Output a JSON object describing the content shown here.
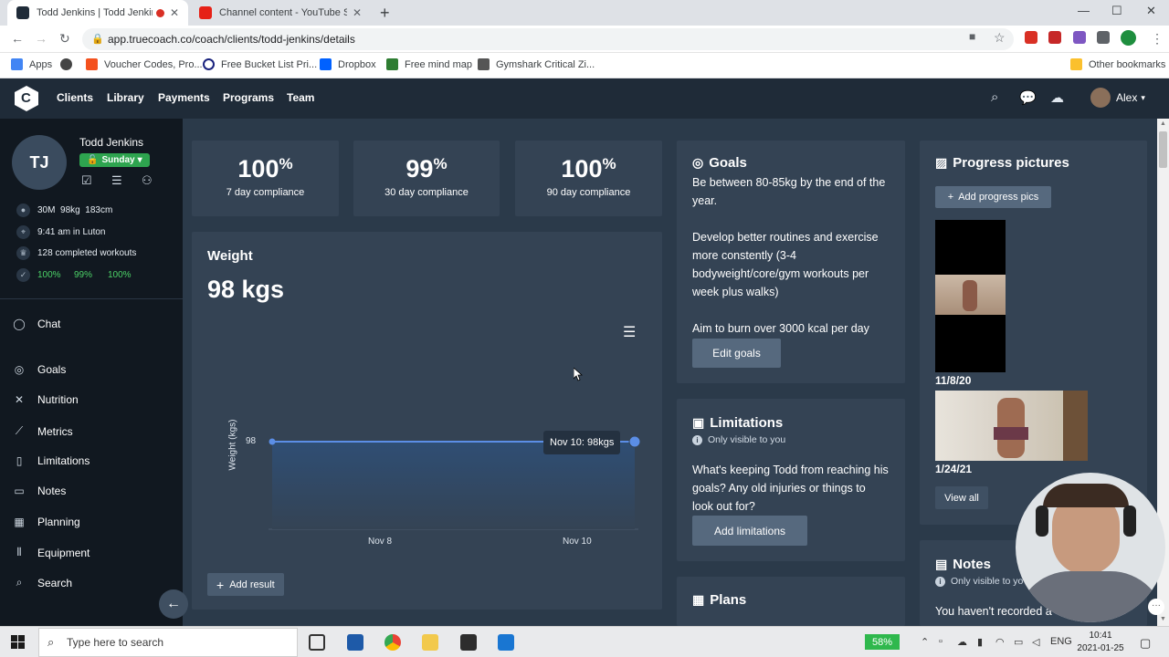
{
  "browser": {
    "tabs": [
      {
        "title": "Todd Jenkins | Todd Jenkins",
        "active": true
      },
      {
        "title": "Channel content - YouTube Studio",
        "active": false
      }
    ],
    "url": "app.truecoach.co/coach/clients/todd-jenkins/details",
    "bookmarks": [
      "Apps",
      "Voucher Codes, Pro...",
      "Free Bucket List Pri...",
      "Dropbox",
      "Free mind map",
      "Gymshark Critical Zi...",
      "Other bookmarks"
    ]
  },
  "appnav": {
    "links": [
      "Clients",
      "Library",
      "Payments",
      "Programs",
      "Team"
    ],
    "user": "Alex"
  },
  "client": {
    "initials": "TJ",
    "name": "Todd Jenkins",
    "day": "Sunday",
    "age_sex": "30M",
    "weight": "98kg",
    "height": "183cm",
    "local_time": "9:41 am in Luton",
    "workouts": "128 completed workouts",
    "compliance_small": [
      "100%",
      "99%",
      "100%"
    ]
  },
  "sidebar_menu": [
    "Chat",
    "Goals",
    "Nutrition",
    "Metrics",
    "Limitations",
    "Notes",
    "Planning",
    "Equipment",
    "Search"
  ],
  "compliance": [
    {
      "value": "100",
      "unit": "%",
      "label": "7 day compliance"
    },
    {
      "value": "99",
      "unit": "%",
      "label": "30 day compliance"
    },
    {
      "value": "100",
      "unit": "%",
      "label": "90 day compliance"
    }
  ],
  "weight_card": {
    "title": "Weight",
    "value": "98 kgs",
    "ylabel": "Weight (kgs)",
    "ytick": "98",
    "xticks": [
      "Nov 8",
      "Nov 10"
    ],
    "tooltip": "Nov 10: 98kgs",
    "add_button": "Add result"
  },
  "chart_data": {
    "type": "area",
    "x": [
      "Nov 7",
      "Nov 10"
    ],
    "values": [
      98,
      98
    ],
    "ylabel": "Weight (kgs)",
    "xticks": [
      "Nov 8",
      "Nov 10"
    ],
    "yticks": [
      98
    ]
  },
  "goals": {
    "title": "Goals",
    "paragraphs": [
      "Be between 80-85kg by the end of the year.",
      "Develop better routines and exercise more constently (3-4 bodyweight/core/gym workouts per week plus walks)",
      "Aim to burn over 3000 kcal per day"
    ],
    "button": "Edit goals"
  },
  "limitations": {
    "title": "Limitations",
    "visibility": "Only visible to you",
    "text": "What's keeping Todd from reaching his goals? Any old injuries or things to look out for?",
    "button": "Add limitations"
  },
  "plans": {
    "title": "Plans"
  },
  "progress": {
    "title": "Progress pictures",
    "add_button": "Add progress pics",
    "dates": [
      "11/8/20",
      "1/24/21"
    ],
    "view_all": "View all"
  },
  "notes": {
    "title": "Notes",
    "visibility": "Only visible to yo",
    "text": "You haven't recorded a"
  },
  "taskbar": {
    "search_placeholder": "Type here to search",
    "battery": "58%",
    "lang": "ENG",
    "time": "10:41",
    "date": "2021-01-25"
  },
  "colors": {
    "nav": "#1f2b38",
    "sidebar": "#111820",
    "card": "#344354",
    "accent_green": "#2ea44f",
    "chart_line": "#5b8ee6"
  }
}
